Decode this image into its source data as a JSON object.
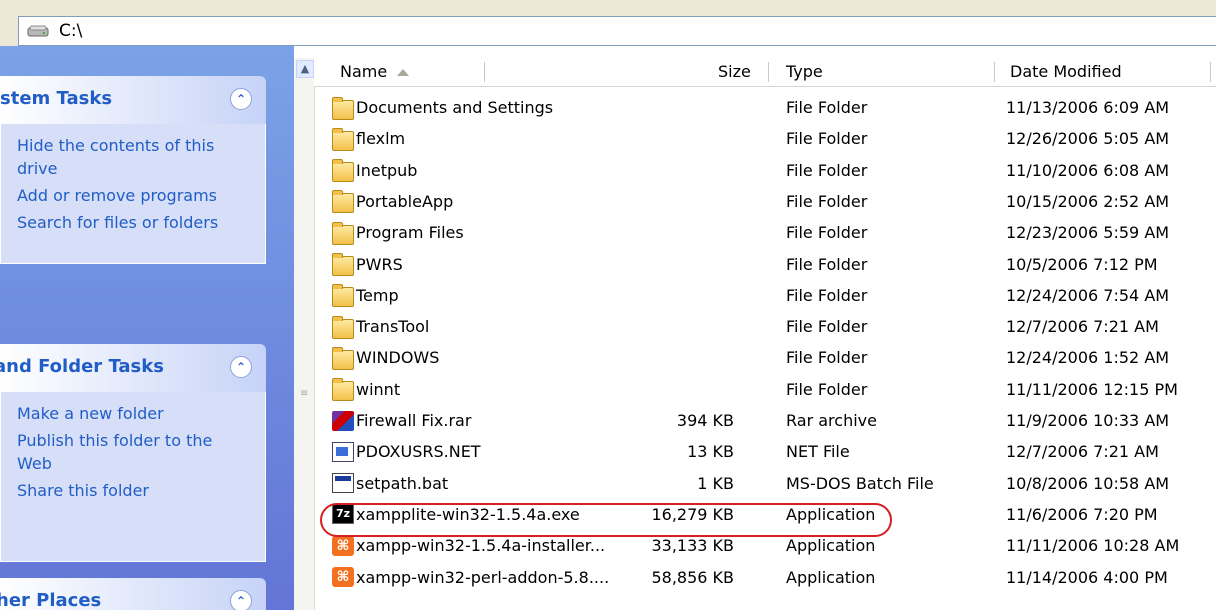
{
  "address": {
    "path": "C:\\"
  },
  "left_pane": {
    "groups": [
      {
        "title": "stem Tasks",
        "links": [
          "Hide the contents of this drive",
          "Add or remove programs",
          "Search for files or folders"
        ]
      },
      {
        "title": "and Folder Tasks",
        "links": [
          "Make a new folder",
          "Publish this folder to the Web",
          "Share this folder"
        ]
      },
      {
        "title": "her Places",
        "links": []
      }
    ]
  },
  "list": {
    "headers": {
      "name": "Name",
      "size": "Size",
      "type": "Type",
      "date": "Date Modified"
    },
    "rows": [
      {
        "icon": "folder-icon",
        "name": "Documents and Settings",
        "size": "",
        "type": "File Folder",
        "date": "11/13/2006 6:09 AM"
      },
      {
        "icon": "folder-icon",
        "name": "flexlm",
        "size": "",
        "type": "File Folder",
        "date": "12/26/2006 5:05 AM"
      },
      {
        "icon": "folder-icon",
        "name": "Inetpub",
        "size": "",
        "type": "File Folder",
        "date": "11/10/2006 6:08 AM"
      },
      {
        "icon": "folder-icon",
        "name": "PortableApp",
        "size": "",
        "type": "File Folder",
        "date": "10/15/2006 2:52 AM"
      },
      {
        "icon": "folder-icon",
        "name": "Program Files",
        "size": "",
        "type": "File Folder",
        "date": "12/23/2006 5:59 AM"
      },
      {
        "icon": "folder-icon",
        "name": "PWRS",
        "size": "",
        "type": "File Folder",
        "date": "10/5/2006 7:12 PM"
      },
      {
        "icon": "folder-icon",
        "name": "Temp",
        "size": "",
        "type": "File Folder",
        "date": "12/24/2006 7:54 AM"
      },
      {
        "icon": "folder-icon",
        "name": "TransTool",
        "size": "",
        "type": "File Folder",
        "date": "12/7/2006 7:21 AM"
      },
      {
        "icon": "folder-icon",
        "name": "WINDOWS",
        "size": "",
        "type": "File Folder",
        "date": "12/24/2006 1:52 AM"
      },
      {
        "icon": "folder-icon",
        "name": "winnt",
        "size": "",
        "type": "File Folder",
        "date": "11/11/2006 12:15 PM"
      },
      {
        "icon": "rar-archive-icon",
        "name": "Firewall Fix.rar",
        "size": "394 KB",
        "type": "Rar archive",
        "date": "11/9/2006 10:33 AM"
      },
      {
        "icon": "net-file-icon",
        "name": "PDOXUSRS.NET",
        "size": "13 KB",
        "type": "NET File",
        "date": "12/7/2006 7:21 AM"
      },
      {
        "icon": "batch-file-icon",
        "name": "setpath.bat",
        "size": "1 KB",
        "type": "MS-DOS Batch File",
        "date": "10/8/2006 10:58 AM"
      },
      {
        "icon": "7zip-app-icon",
        "name": "xampplite-win32-1.5.4a.exe",
        "size": "16,279 KB",
        "type": "Application",
        "date": "11/6/2006 7:20 PM"
      },
      {
        "icon": "xampp-app-icon",
        "name": "xampp-win32-1.5.4a-installer...",
        "size": "33,133 KB",
        "type": "Application",
        "date": "11/11/2006 10:28 AM"
      },
      {
        "icon": "xampp-app-icon",
        "name": "xampp-win32-perl-addon-5.8....",
        "size": "58,856 KB",
        "type": "Application",
        "date": "11/14/2006 4:00 PM"
      }
    ]
  },
  "colors": {
    "task_link": "#215dc6",
    "highlight": "#d42020",
    "pane_bg": "#7ba2e7"
  }
}
